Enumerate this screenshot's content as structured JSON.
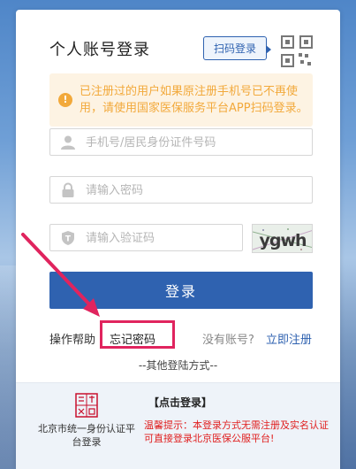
{
  "header": {
    "title": "个人账号登录",
    "qr_button_label": "扫码登录"
  },
  "notice": {
    "icon": "exclamation-circle-icon",
    "text": "已注册过的用户如果原注册手机号已不再使用，请使用国家医保服务平台APP扫码登录。"
  },
  "form": {
    "account_placeholder": "手机号/居民身份证件号码",
    "password_placeholder": "请输入密码",
    "captcha_placeholder": "请输入验证码",
    "captcha_text": "ygwh",
    "login_label": "登录"
  },
  "links": {
    "help_label": "操作帮助",
    "forgot_password": "忘记密码",
    "no_account": "没有账号?",
    "register": "立即注册",
    "other_methods": "--其他登陆方式--"
  },
  "alt_login": {
    "platform_label": "北京市统一身份认证平台登录",
    "click_login": "【点击登录】",
    "tip": "温馨提示：本登录方式无需注册及实名认证可直接登录北京医保公服平台!"
  },
  "colors": {
    "primary": "#2f62b0",
    "warning": "#f2a93b",
    "highlight": "#e0245e",
    "tip_red": "#e02020"
  }
}
